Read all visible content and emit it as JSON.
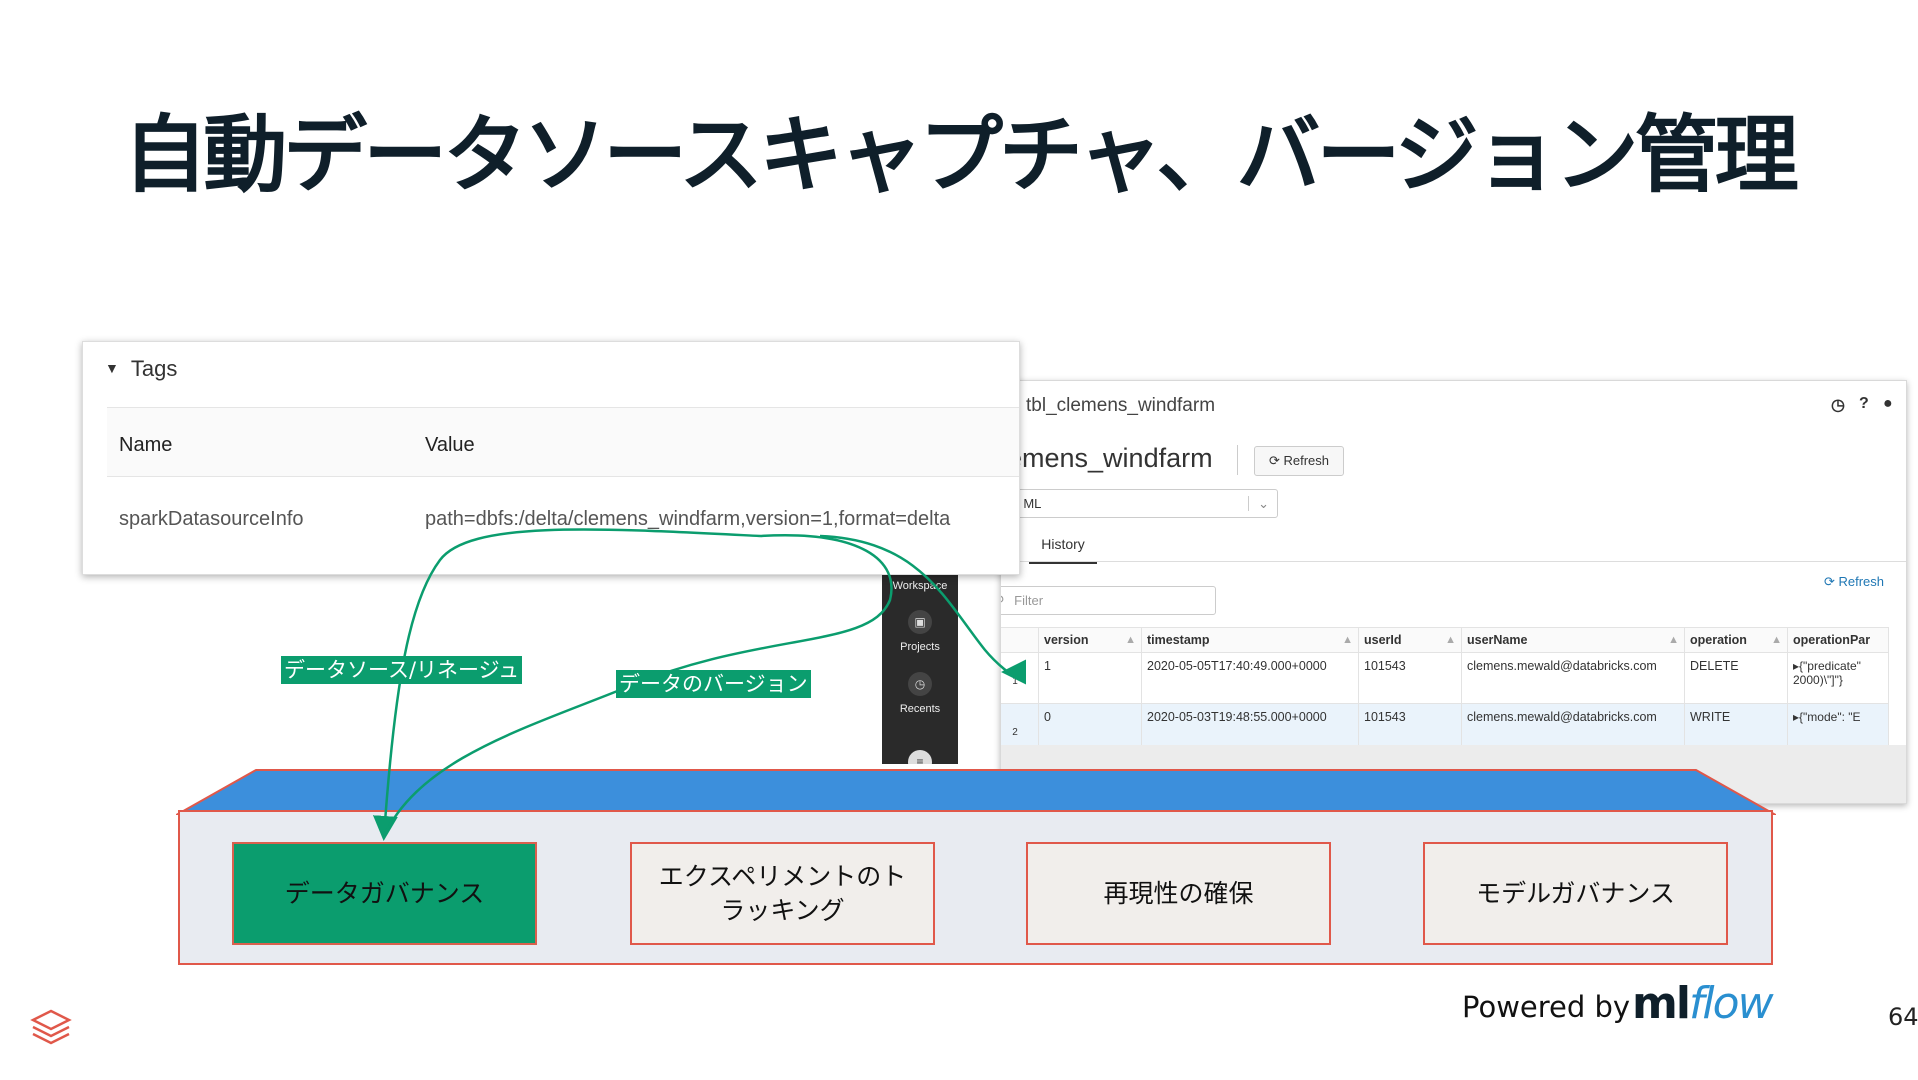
{
  "slide": {
    "title": "自動データソースキャプチャ、バージョン管理",
    "page_number": "64",
    "powered_by": "Powered by",
    "mlflow_ml": "ml",
    "mlflow_flow": "flow"
  },
  "tags_panel": {
    "header": "Tags",
    "columns": [
      "Name",
      "Value"
    ],
    "row": {
      "name": "sparkDatasourceInfo",
      "value": "path=dbfs:/delta/clemens_windfarm,version=1,format=delta"
    }
  },
  "delta_panel": {
    "breadcrumb": "tbl_clemens_windfarm",
    "table_name": "lemens_windfarm",
    "refresh_label": "Refresh",
    "select_value": "ns ML",
    "tab_history": "History",
    "refresh2_label": "Refresh",
    "filter_placeholder": "Filter",
    "columns": [
      "version",
      "timestamp",
      "userId",
      "userName",
      "operation",
      "operationPar"
    ],
    "rows": [
      {
        "idx": "1",
        "version": "1",
        "timestamp": "2020-05-05T17:40:49.000+0000",
        "userId": "101543",
        "userName": "clemens.mewald@databricks.com",
        "operation": "DELETE",
        "params": "{\"predicate\" 2000)\\\"]\"}"
      },
      {
        "idx": "2",
        "version": "0",
        "timestamp": "2020-05-03T19:48:55.000+0000",
        "userId": "101543",
        "userName": "clemens.mewald@databricks.com",
        "operation": "WRITE",
        "params": "{\"mode\": \"E"
      }
    ]
  },
  "sidebar": {
    "items": [
      "Workspace",
      "Projects",
      "Recents"
    ]
  },
  "annotations": {
    "lineage": "データソース/リネージュ",
    "version": "データのバージョン"
  },
  "cards": [
    {
      "label": "データガバナンス",
      "highlighted": true
    },
    {
      "label": "エクスペリメントのトラッキング",
      "line1": "エクスペリメントのト",
      "line2": "ラッキング",
      "highlighted": false
    },
    {
      "label": "再現性の確保",
      "highlighted": false
    },
    {
      "label": "モデルガバナンス",
      "highlighted": false
    }
  ],
  "colors": {
    "accent_green": "#0b9d6e",
    "box_top_blue": "#3c8fdc",
    "border_red": "#e0584a",
    "title": "#0f1f2a"
  }
}
